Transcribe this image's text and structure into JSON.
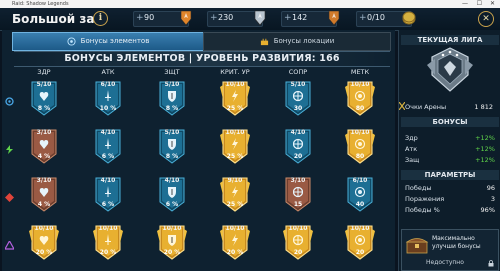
{
  "window": {
    "title": "Raid: Shadow Legends",
    "min_glyph": "—",
    "max_glyph": "☐",
    "close_glyph": "✕"
  },
  "top": {
    "title": "Большой зал",
    "info_glyph": "i",
    "close_glyph": "✕",
    "resources": [
      {
        "value": "90",
        "icon": "gold-flag-icon",
        "color": "#e0852a"
      },
      {
        "value": "230",
        "icon": "silver-flag-icon",
        "color": "#b8c4cf"
      },
      {
        "value": "142",
        "icon": "bronze-flag-icon",
        "color": "#d07a2a"
      },
      {
        "value": "0/10",
        "icon": "arena-token-icon",
        "color": "#d4b040"
      }
    ]
  },
  "tabs": [
    {
      "label": "Бонусы элементов",
      "active": true
    },
    {
      "label": "Бонусы локации",
      "active": false
    }
  ],
  "header": "БОНУСЫ ЭЛЕМЕНТОВ | УРОВЕНЬ РАЗВИТИЯ: 166",
  "columns": [
    "ЗДР",
    "АТК",
    "ЗЩТ",
    "КРИТ. УР",
    "СОПР",
    "МЕТК"
  ],
  "rows": [
    {
      "affinity": "magic",
      "color": "#4aa8e8",
      "tiles": [
        {
          "level": "5/10",
          "bonus": "8 %",
          "style": "blue",
          "sym": "heart"
        },
        {
          "level": "6/10",
          "bonus": "10 %",
          "style": "blue",
          "sym": "sword"
        },
        {
          "level": "5/10",
          "bonus": "8 %",
          "style": "blue",
          "sym": "shield"
        },
        {
          "level": "10/10",
          "bonus": "25 %",
          "style": "gold",
          "sym": "crit"
        },
        {
          "level": "5/10",
          "bonus": "30",
          "style": "blue",
          "sym": "resist"
        },
        {
          "level": "10/10",
          "bonus": "80",
          "style": "gold",
          "sym": "acc"
        }
      ]
    },
    {
      "affinity": "force",
      "color": "#5fd34a",
      "tiles": [
        {
          "level": "3/10",
          "bonus": "4 %",
          "style": "bronze",
          "sym": "heart"
        },
        {
          "level": "4/10",
          "bonus": "6 %",
          "style": "blue",
          "sym": "sword"
        },
        {
          "level": "5/10",
          "bonus": "8 %",
          "style": "blue",
          "sym": "shield"
        },
        {
          "level": "10/10",
          "bonus": "25 %",
          "style": "gold",
          "sym": "crit"
        },
        {
          "level": "4/10",
          "bonus": "20",
          "style": "blue",
          "sym": "resist"
        },
        {
          "level": "10/10",
          "bonus": "80",
          "style": "gold",
          "sym": "acc"
        }
      ]
    },
    {
      "affinity": "spirit",
      "color": "#e0443a",
      "tiles": [
        {
          "level": "3/10",
          "bonus": "4 %",
          "style": "bronze",
          "sym": "heart"
        },
        {
          "level": "4/10",
          "bonus": "6 %",
          "style": "blue",
          "sym": "sword"
        },
        {
          "level": "4/10",
          "bonus": "6 %",
          "style": "blue",
          "sym": "shield"
        },
        {
          "level": "9/10",
          "bonus": "25 %",
          "style": "gold",
          "sym": "crit"
        },
        {
          "level": "3/10",
          "bonus": "15",
          "style": "bronze",
          "sym": "resist"
        },
        {
          "level": "6/10",
          "bonus": "40",
          "style": "blue",
          "sym": "acc"
        }
      ]
    },
    {
      "affinity": "void",
      "color": "#b460e0",
      "tiles": [
        {
          "level": "10/10",
          "bonus": "20 %",
          "style": "gold",
          "sym": "heart"
        },
        {
          "level": "10/10",
          "bonus": "20 %",
          "style": "gold",
          "sym": "sword"
        },
        {
          "level": "10/10",
          "bonus": "20 %",
          "style": "gold",
          "sym": "shield"
        },
        {
          "level": "10/10",
          "bonus": "20 %",
          "style": "gold",
          "sym": "crit"
        },
        {
          "level": "10/10",
          "bonus": "20",
          "style": "gold",
          "sym": "resist"
        },
        {
          "level": "10/10",
          "bonus": "20",
          "style": "gold",
          "sym": "acc"
        }
      ]
    }
  ],
  "panel": {
    "league_title": "ТЕКУЩАЯ ЛИГА",
    "arena_label": "Очки Арены",
    "arena_value": "1 812",
    "bonuses_title": "БОНУСЫ",
    "bonuses": [
      {
        "label": "Здр",
        "value": "+12%"
      },
      {
        "label": "Атк",
        "value": "+12%"
      },
      {
        "label": "Защ",
        "value": "+12%"
      }
    ],
    "params_title": "ПАРАМЕТРЫ",
    "params": [
      {
        "label": "Победы",
        "value": "96"
      },
      {
        "label": "Поражения",
        "value": "3"
      },
      {
        "label": "Победы %",
        "value": "96%"
      }
    ],
    "boost_text": "Максимально улучши бонусы",
    "boost_status": "Недоступно"
  },
  "colors": {
    "gold": "#e8b030",
    "blue": "#1f7ea3",
    "bronze": "#a0604a",
    "accent": "#3a7fb0"
  }
}
